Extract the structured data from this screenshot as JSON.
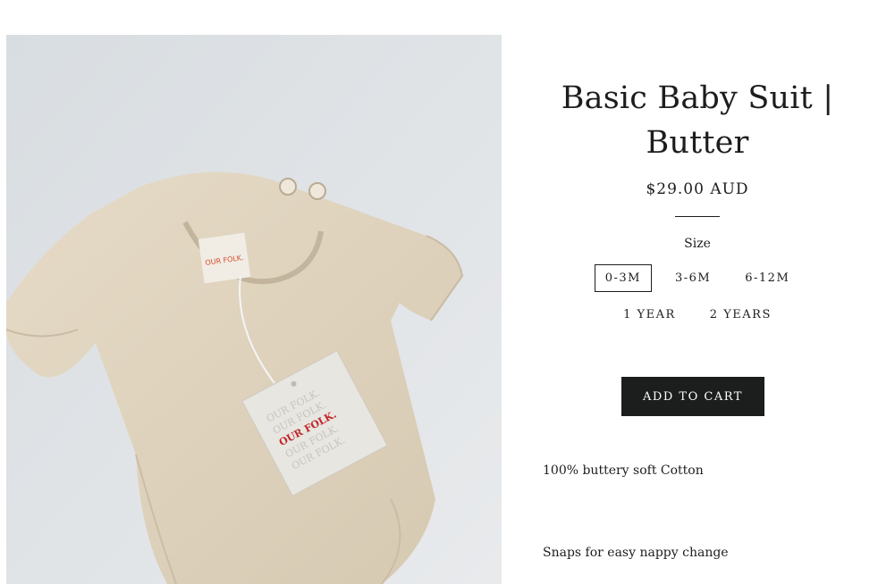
{
  "product": {
    "title": "Basic Baby Suit | Butter",
    "price": "$29.00 AUD",
    "image_alt": "Butter coloured short sleeve baby suit with Our Folk swing tag",
    "size_label": "Size",
    "sizes": [
      "0-3M",
      "3-6M",
      "6-12M",
      "1 YEAR",
      "2 YEARS"
    ],
    "selected_size": "0-3M",
    "add_to_cart": "ADD TO CART",
    "description": [
      "100% buttery soft Cotton",
      "Snaps for easy nappy change"
    ],
    "tag_text": [
      "OUR FOLK.",
      "OUR FOLK.",
      "OUR FOLK.",
      "OUR FOLK.",
      "OUR FOLK."
    ],
    "neck_label": "OUR FOLK."
  },
  "colors": {
    "background": "#ffffff",
    "text": "#1c1d1d",
    "button": "#1c1d1d",
    "button_text": "#ffffff",
    "garment": "#e2d6c1",
    "tag_red": "#c0262b"
  }
}
